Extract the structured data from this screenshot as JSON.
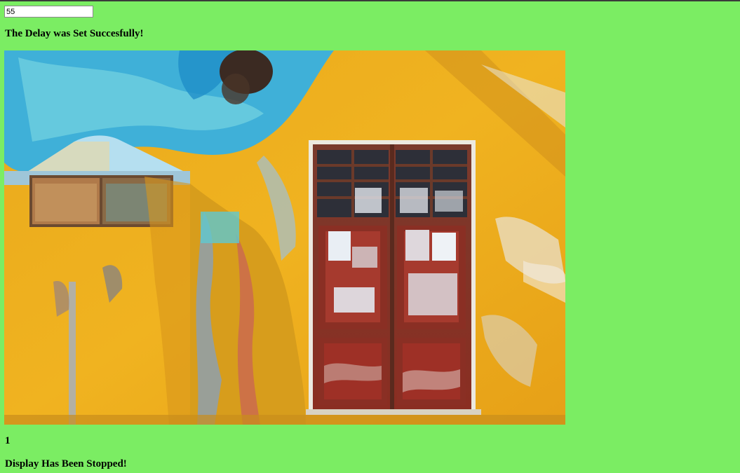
{
  "delay_input": {
    "value": "55"
  },
  "messages": {
    "delay_set": "The Delay was Set Succesfully!",
    "counter": "1",
    "display_stopped": "Display Has Been Stopped!"
  },
  "image": {
    "description_icon": "weathered-wall-with-door-photo"
  },
  "colors": {
    "page_background": "#7bed63"
  }
}
